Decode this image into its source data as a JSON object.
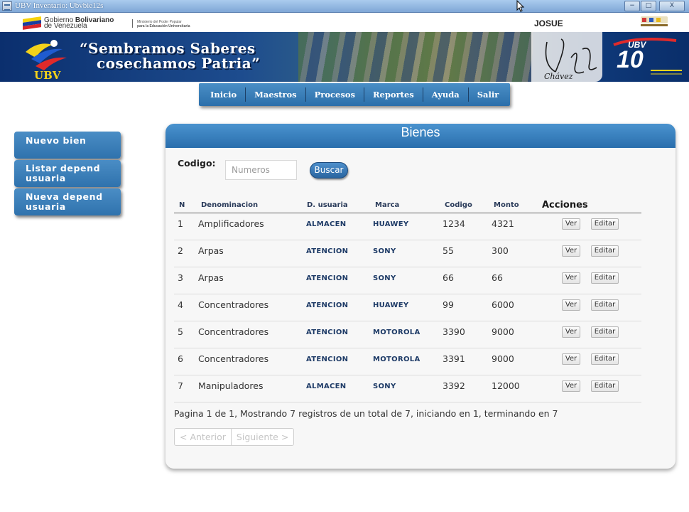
{
  "window": {
    "title": "UBV Inventario: Ubvbie12s",
    "buttons": [
      "−",
      "□",
      "X"
    ]
  },
  "header": {
    "gov_line1_a": "Gobierno ",
    "gov_line1_b": "Bolivariano",
    "gov_line2": "de Venezuela",
    "ministry_line1": "Ministerio del Poder Popular",
    "ministry_line2": "para la Educación Universitaria",
    "user": "JOSUE",
    "slogan_line1": "“Sembramos Saberes",
    "slogan_line2": "cosechamos Patria”",
    "logo_text": "UBV",
    "signature": "Chávez",
    "badge_text": "UBV",
    "badge_number": "10"
  },
  "nav": {
    "items": [
      "Inicio",
      "Maestros",
      "Procesos",
      "Reportes",
      "Ayuda",
      "Salir"
    ]
  },
  "sidebar": {
    "items": [
      "Nuevo bien",
      "Listar depend usuaria",
      "Nueva depend usuaria"
    ]
  },
  "panel": {
    "title": "Bienes",
    "search": {
      "label": "Codigo:",
      "placeholder": "Numeros",
      "button": "Buscar"
    },
    "columns": [
      "N",
      "Denominacion",
      "D. usuaria",
      "Marca",
      "Codigo",
      "Monto",
      "Acciones"
    ],
    "rows": [
      {
        "n": "1",
        "denominacion": "Amplificadores",
        "dusuaria": "ALMACEN",
        "marca": "HUAWEY",
        "codigo": "1234",
        "monto": "4321"
      },
      {
        "n": "2",
        "denominacion": "Arpas",
        "dusuaria": "ATENCION",
        "marca": "SONY",
        "codigo": "55",
        "monto": "300"
      },
      {
        "n": "3",
        "denominacion": "Arpas",
        "dusuaria": "ATENCION",
        "marca": "SONY",
        "codigo": "66",
        "monto": "66"
      },
      {
        "n": "4",
        "denominacion": "Concentradores",
        "dusuaria": "ATENCION",
        "marca": "HUAWEY",
        "codigo": "99",
        "monto": "6000"
      },
      {
        "n": "5",
        "denominacion": "Concentradores",
        "dusuaria": "ATENCION",
        "marca": "MOTOROLA",
        "codigo": "3390",
        "monto": "9000"
      },
      {
        "n": "6",
        "denominacion": "Concentradores",
        "dusuaria": "ATENCION",
        "marca": "MOTOROLA",
        "codigo": "3391",
        "monto": "9000"
      },
      {
        "n": "7",
        "denominacion": "Manipuladores",
        "dusuaria": "ALMACEN",
        "marca": "SONY",
        "codigo": "3392",
        "monto": "12000"
      }
    ],
    "actions": {
      "view": "Ver",
      "edit": "Editar"
    },
    "page_info": "Pagina 1 de 1, Mostrando 7 registros de un total de 7, iniciando en 1, terminando en 7",
    "pager": {
      "prev": "< Anterior",
      "next": "Siguiente >"
    }
  },
  "colors": {
    "accent": "#2f72ad",
    "banner": "#0b2f6e",
    "link_text": "#1d3a66"
  }
}
